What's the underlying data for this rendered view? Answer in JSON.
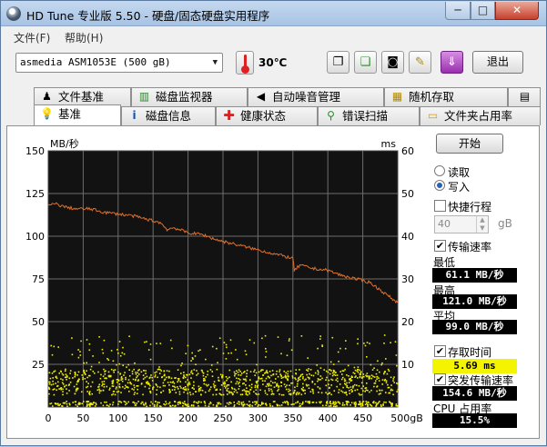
{
  "window": {
    "title": "HD Tune 专业版 5.50 - 硬盘/固态硬盘实用程序",
    "min": "─",
    "max": "□",
    "close": "✕"
  },
  "menu": {
    "file": "文件(F)",
    "help": "帮助(H)"
  },
  "toolbar": {
    "drive": "asmedia ASM1053E (500 gB)",
    "temperature": "30℃",
    "exit": "退出",
    "icons": [
      "copy-info-icon",
      "copy-text-icon",
      "screenshot-camera-icon",
      "options-tools-icon",
      "download-update-icon"
    ]
  },
  "tabs_top": [
    "文件基准",
    "磁盘监视器",
    "自动噪音管理",
    "随机存取"
  ],
  "tabs_bottom": [
    "基准",
    "磁盘信息",
    "健康状态",
    "错误扫描",
    "文件夹占用率"
  ],
  "chart_data": {
    "type": "line",
    "ylabel_left": "MB/秒",
    "ylabel_right": "ms",
    "y_left_ticks": [
      "150",
      "125",
      "100",
      "75",
      "50",
      "25"
    ],
    "y_right_ticks": [
      "60",
      "50",
      "40",
      "30",
      "20",
      "10"
    ],
    "x_ticks": [
      "0",
      "50",
      "100",
      "150",
      "200",
      "250",
      "300",
      "350",
      "400",
      "450",
      "500gB"
    ],
    "xlim": [
      0,
      500
    ],
    "ylim_left": [
      0,
      150
    ],
    "ylim_right": [
      0,
      60
    ],
    "grid": true,
    "colors": {
      "background": "#121212",
      "grid": "#6e6e6e",
      "transfer": "#e0702a",
      "access": "#f0f000"
    },
    "transfer_rate": {
      "name": "传输速率",
      "x": [
        0,
        10,
        25,
        40,
        60,
        80,
        100,
        120,
        140,
        160,
        170,
        180,
        200,
        220,
        240,
        260,
        280,
        300,
        320,
        340,
        350,
        352,
        360,
        380,
        400,
        420,
        440,
        460,
        470,
        480,
        490,
        500
      ],
      "y": [
        118,
        119,
        117,
        116,
        116,
        114,
        113,
        112,
        110,
        108,
        104,
        105,
        102,
        101,
        98,
        96,
        94,
        92,
        90,
        88,
        87,
        80,
        83,
        81,
        80,
        77,
        75,
        73,
        70,
        67,
        64,
        61
      ]
    },
    "access_time": {
      "name": "存取时间",
      "typical_ms": [
        1,
        9
      ],
      "outlier_ms": [
        9,
        17
      ]
    }
  },
  "right_panel": {
    "start": "开始",
    "read": "读取",
    "write": "写入",
    "short_stroke": "快捷行程",
    "short_stroke_value": "40",
    "short_stroke_unit": "gB",
    "transfer_rate": "传输速率",
    "min_label": "最低",
    "min_value": "61.1 MB/秒",
    "max_label": "最高",
    "max_value": "121.0 MB/秒",
    "avg_label": "平均",
    "avg_value": "99.0 MB/秒",
    "access_time": "存取时间",
    "access_value": "5.69 ms",
    "burst_rate": "突发传输速率",
    "burst_value": "154.6 MB/秒",
    "cpu_label": "CPU 占用率",
    "cpu_value": "15.5%"
  }
}
